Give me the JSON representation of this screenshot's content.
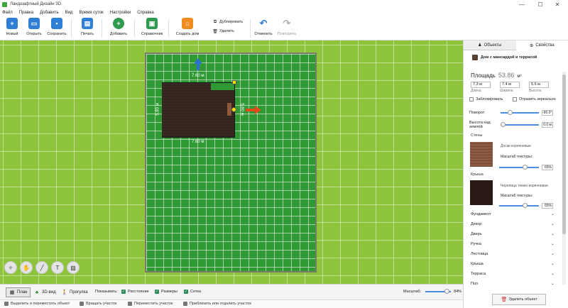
{
  "window": {
    "title": "Ландшафтный Дизайн 3D",
    "minimize": "—",
    "maximize": "☐",
    "close": "✕"
  },
  "menu": [
    "Файл",
    "Правка",
    "Добавить",
    "Вид",
    "Время суток",
    "Настройки",
    "Справка"
  ],
  "toolbar": {
    "new": "Новый",
    "open": "Открыть",
    "save": "Сохранить",
    "print": "Печать",
    "add": "Добавить",
    "reference": "Справочник",
    "create_house": "Создать дом",
    "duplicate": "Дублировать",
    "delete": "Удалить",
    "undo": "Отменить",
    "redo": "Повторить"
  },
  "canvas": {
    "dim_top": "7.60 м",
    "dim_bottom": "7.60 м",
    "dim_left": "5.80 м",
    "dim_right": "5.80 м"
  },
  "panel": {
    "tab_objects": "Объекты",
    "tab_properties": "Свойства",
    "object_name": "Дом с мансардой и террасой",
    "area_label": "Площадь",
    "area_value": "53.86",
    "area_unit": "м²",
    "length_value": "7.3 м",
    "width_value": "7.4 м",
    "height_value": "5.6 м",
    "length_cap": "Длина",
    "width_cap": "Ширина",
    "height_cap": "Высота",
    "lock_label": "Заблокировать",
    "mirror_label": "Отразить зеркально",
    "rotation_label": "Поворот",
    "rotation_value": "-90.0°",
    "rotation_level": 0.25,
    "elevation_label": "Высота над землёй",
    "elevation_value": "0.0 м",
    "elevation_level": 0.0,
    "walls_label": "Стены",
    "walls_texture": "Доски коричневые",
    "walls_scale_label": "Масштаб текстуры:",
    "walls_scale_value": "65%",
    "walls_scale_level": 0.65,
    "roof_label": "Крыша",
    "roof_texture": "Черепица темно-коричневая",
    "roof_scale_label": "Масштаб текстуры:",
    "roof_scale_value": "65%",
    "roof_scale_level": 0.65,
    "sections": [
      "Фундамент",
      "Декор",
      "Дверь",
      "Ручка",
      "Лестница",
      "Крыша",
      "Терраса",
      "Пол"
    ],
    "delete_object": "Удалить объект",
    "walls_color": "#8a5a42",
    "roof_color": "#2a1a16"
  },
  "bottom": {
    "view_plan": "План",
    "view_3d": "3D-вид",
    "view_walk": "Прогулка",
    "show_label": "Показывать:",
    "distance": "Расстояние",
    "sizes": "Размеры",
    "grid": "Сетка",
    "zoom_label": "Масштаб:",
    "zoom_value": "84%",
    "zoom_level": 0.84
  },
  "status": {
    "hint1": "Выделить и переместить объект",
    "hint2": "Вращать участок",
    "hint3": "Переместить участок",
    "hint4": "Приблизить или отдалить участок"
  },
  "tools": [
    "compass-icon",
    "hand-icon",
    "ruler-icon",
    "text-icon",
    "image-icon"
  ]
}
